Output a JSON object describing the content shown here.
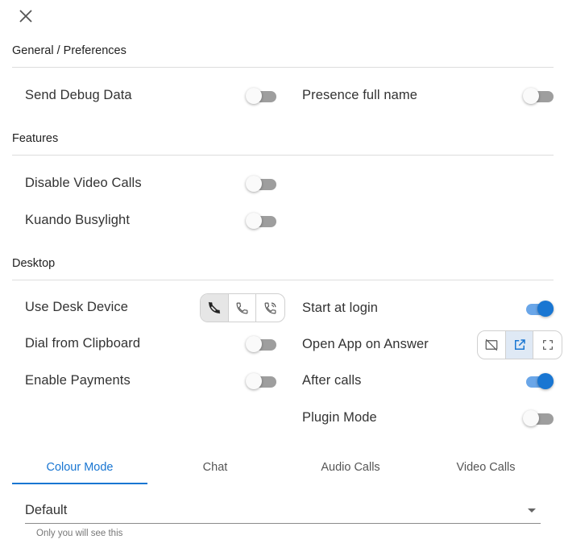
{
  "sections": {
    "general": "General / Preferences",
    "features": "Features",
    "desktop": "Desktop"
  },
  "settings": {
    "send_debug_data": {
      "label": "Send Debug Data",
      "enabled": false
    },
    "presence_full_name": {
      "label": "Presence full name",
      "enabled": false
    },
    "disable_video_calls": {
      "label": "Disable Video Calls",
      "enabled": false
    },
    "kuando_busylight": {
      "label": "Kuando Busylight",
      "enabled": false
    },
    "use_desk_device": {
      "label": "Use Desk Device",
      "options": [
        "no-desk-phone-icon",
        "desk-phone-icon",
        "phone-ringing-icon"
      ],
      "selected": 0
    },
    "start_at_login": {
      "label": "Start at login",
      "enabled": true
    },
    "dial_from_clipboard": {
      "label": "Dial from Clipboard",
      "enabled": false
    },
    "open_app_on_answer": {
      "label": "Open App on Answer",
      "options": [
        "no-window-icon",
        "open-in-new-icon",
        "fullscreen-icon"
      ],
      "selected": 1
    },
    "enable_payments": {
      "label": "Enable Payments",
      "enabled": false
    },
    "after_calls": {
      "label": "After calls",
      "enabled": true
    },
    "plugin_mode": {
      "label": "Plugin Mode",
      "enabled": false
    }
  },
  "tabs": [
    {
      "label": "Colour Mode",
      "active": true
    },
    {
      "label": "Chat",
      "active": false
    },
    {
      "label": "Audio Calls",
      "active": false
    },
    {
      "label": "Video Calls",
      "active": false
    }
  ],
  "colour_mode": {
    "value": "Default",
    "helper": "Only you will see this"
  },
  "colors": {
    "accent": "#1976d2",
    "toggle_off_track": "#9e9e9e",
    "toggle_on_track": "#6aa6e8"
  }
}
